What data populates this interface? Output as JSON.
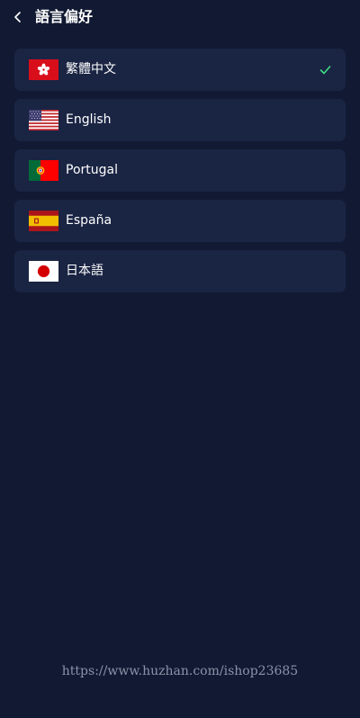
{
  "header": {
    "title": "語言偏好",
    "back_icon": "chevron-left-icon"
  },
  "languages": [
    {
      "label": "繁體中文",
      "flag": "hong-kong-flag-icon",
      "selected": true
    },
    {
      "label": "English",
      "flag": "usa-flag-icon",
      "selected": false
    },
    {
      "label": "Portugal",
      "flag": "portugal-flag-icon",
      "selected": false
    },
    {
      "label": "España",
      "flag": "spain-flag-icon",
      "selected": false
    },
    {
      "label": "日本語",
      "flag": "japan-flag-icon",
      "selected": false
    }
  ],
  "selected_indicator": {
    "icon": "checkmark-icon",
    "color": "#3ddc84"
  },
  "watermark": "https://www.huzhan.com/ishop23685",
  "colors": {
    "background": "#121a33",
    "card": "#1a2443",
    "text": "#ffffff"
  }
}
